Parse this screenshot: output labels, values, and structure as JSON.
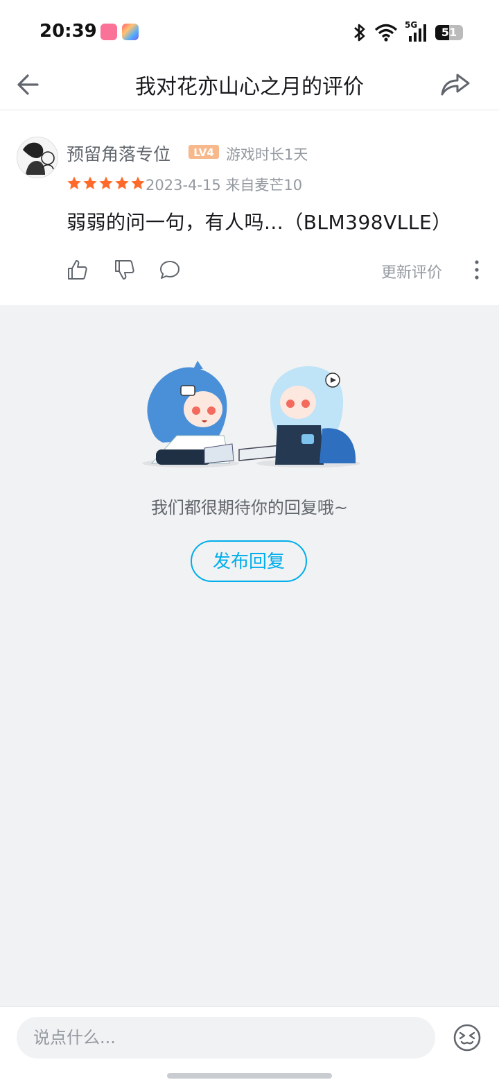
{
  "status_bar": {
    "time": "20:39",
    "network": "5G",
    "battery": "51",
    "apps": [
      "bilibili-icon",
      "star-app-icon"
    ]
  },
  "header": {
    "title": "我对花亦山心之月的评价",
    "back_icon": "arrow-left-icon",
    "share_icon": "share-arrow-icon"
  },
  "review": {
    "username": "预留角落专位",
    "level": "LV4",
    "playtime": "游戏时长1天",
    "rating": 5,
    "date": "2023-4-15",
    "source": "来自麦芒10",
    "content": "弱弱的问一句，有人吗...（BLM398VLLE）",
    "update_label": "更新评价",
    "star_color": "#ff6a2a"
  },
  "empty_state": {
    "message": "我们都很期待你的回复哦~",
    "post_button": "发布回复"
  },
  "composer": {
    "placeholder": "说点什么..."
  },
  "colors": {
    "accent": "#00aeec",
    "background": "#f1f2f3",
    "level_badge": "#f7b98b"
  }
}
